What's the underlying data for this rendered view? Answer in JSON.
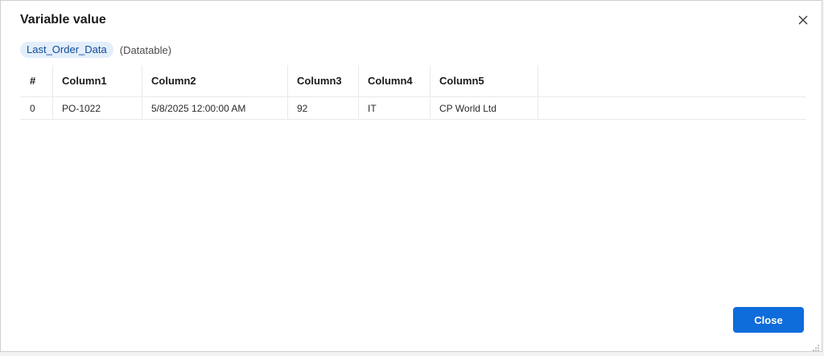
{
  "dialog": {
    "title": "Variable value",
    "close_icon": "close-icon",
    "close_button_label": "Close",
    "accent_color": "#0f6cdb"
  },
  "variable": {
    "name": "Last_Order_Data",
    "type": "(Datatable)"
  },
  "table": {
    "headers": [
      "#",
      "Column1",
      "Column2",
      "Column3",
      "Column4",
      "Column5"
    ],
    "rows": [
      [
        "0",
        "PO-1022",
        "5/8/2025 12:00:00 AM",
        "92",
        "IT",
        "CP World Ltd"
      ]
    ]
  }
}
